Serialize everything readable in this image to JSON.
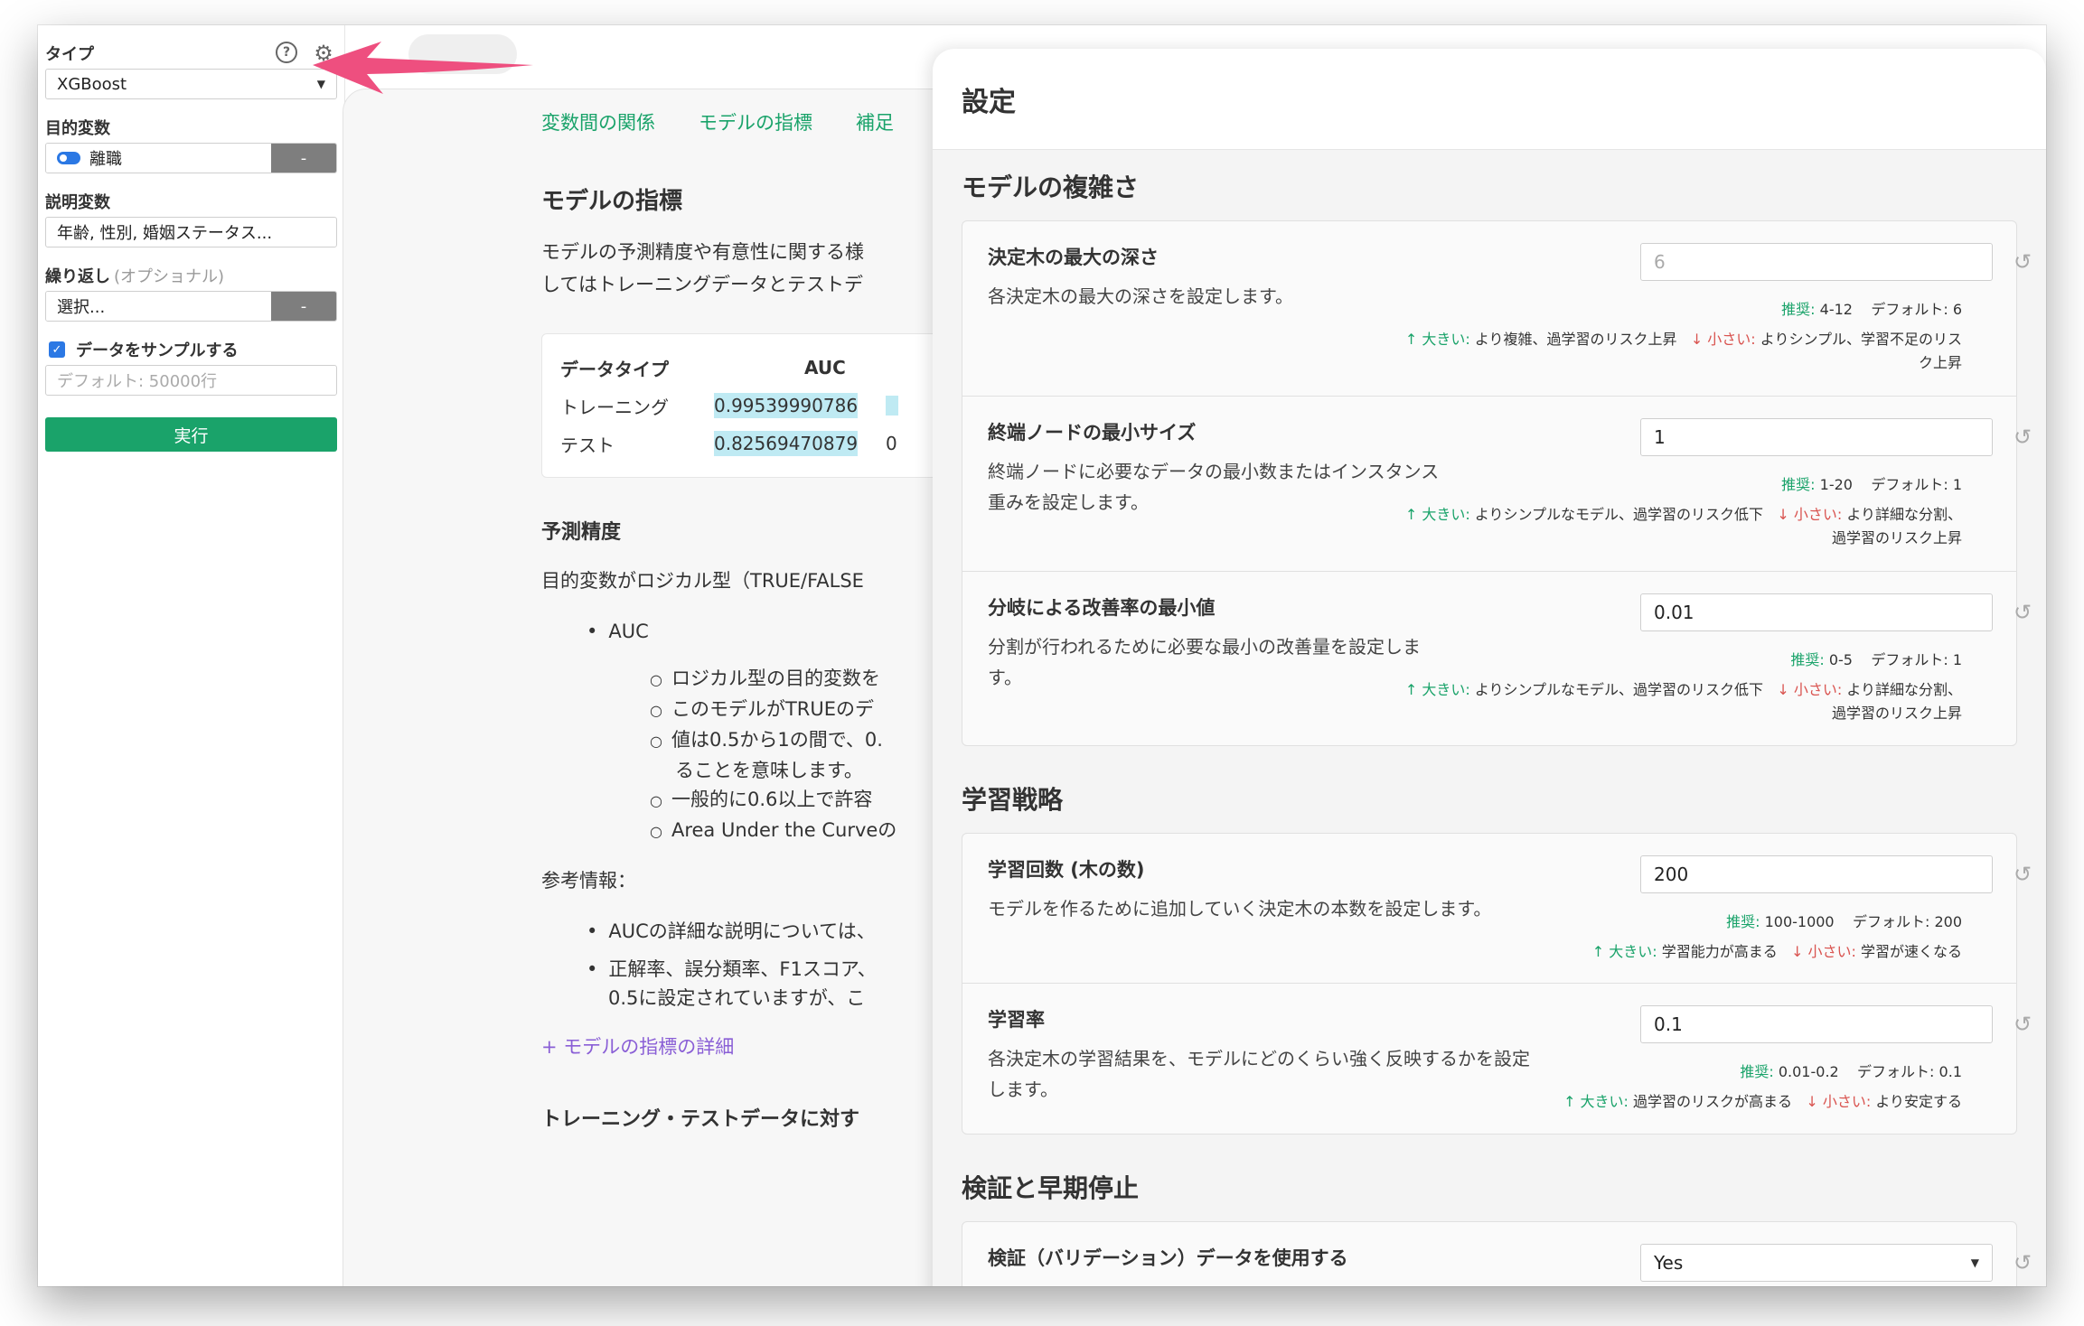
{
  "sidebar": {
    "type_label": "タイプ",
    "type_value": "XGBoost",
    "target_label": "目的変数",
    "target_value": "離職",
    "target_btn": "-",
    "features_label": "説明変数",
    "features_value": "年齢, 性別, 婚姻ステータス...",
    "repeat_label": "繰り返し",
    "repeat_optional": "(オプショナル)",
    "repeat_value": "選択...",
    "repeat_btn": "-",
    "sample_label": "データをサンプルする",
    "sample_placeholder": "デフォルト: 50000行",
    "run_label": "実行"
  },
  "doc": {
    "tabs": [
      "変数間の関係",
      "モデルの指標",
      "補足"
    ],
    "heading": "モデルの指標",
    "intro_line1": "モデルの予測精度や有意性に関する様",
    "intro_line2": "してはトレーニングデータとテストデ",
    "table": {
      "headers": [
        "データタイプ",
        "AUC"
      ],
      "rows": [
        {
          "type": "トレーニング",
          "auc": "0.99539990786"
        },
        {
          "type": "テスト",
          "auc": "0.82569470879"
        }
      ],
      "cut_mark": "0"
    },
    "accuracy_heading": "予測精度",
    "accuracy_text": "目的変数がロジカル型（TRUE/FALSE",
    "bullet_auc": "AUC",
    "sub_bullets": [
      "ロジカル型の目的変数を",
      "このモデルがTRUEのデ",
      "値は0.5から1の間で、0.",
      "一般的に0.6以上で許容",
      "Area Under the Curveの"
    ],
    "sub_bullet_cont": "ることを意味します。",
    "reference_label": "参考情報：",
    "ref_bullets": [
      "AUCの詳細な説明については、",
      "正解率、誤分類率、F1スコア、"
    ],
    "ref_cont": "0.5に設定されていますが、こ",
    "detail_link": "+ モデルの指標の詳細",
    "bottom_heading": "トレーニング・テストデータに対す"
  },
  "modal": {
    "title": "設定",
    "sections": [
      {
        "title": "モデルの複雑さ",
        "params": [
          {
            "name": "決定木の最大の深さ",
            "desc": "各決定木の最大の深さを設定します。",
            "value": "",
            "placeholder": "6",
            "rec_label": "推奨:",
            "rec": "4-12",
            "default_label": "デフォルト:",
            "default": "6",
            "up_label": "↑ 大きい:",
            "up_text": "より複雑、過学習のリスク上昇",
            "down_label": "↓ 小さい:",
            "down_text": "よりシンプル、学習不足のリスク上昇"
          },
          {
            "name": "終端ノードの最小サイズ",
            "desc": "終端ノードに必要なデータの最小数またはインスタンス重みを設定します。",
            "value": "1",
            "placeholder": "",
            "rec_label": "推奨:",
            "rec": "1-20",
            "default_label": "デフォルト:",
            "default": "1",
            "up_label": "↑ 大きい:",
            "up_text": "よりシンプルなモデル、過学習のリスク低下",
            "down_label": "↓ 小さい:",
            "down_text": "より詳細な分割、過学習のリスク上昇"
          },
          {
            "name": "分岐による改善率の最小値",
            "desc": "分割が行われるために必要な最小の改善量を設定します。",
            "value": "0.01",
            "placeholder": "",
            "rec_label": "推奨:",
            "rec": "0-5",
            "default_label": "デフォルト:",
            "default": "1",
            "up_label": "↑ 大きい:",
            "up_text": "よりシンプルなモデル、過学習のリスク低下",
            "down_label": "↓ 小さい:",
            "down_text": "より詳細な分割、過学習のリスク上昇"
          }
        ]
      },
      {
        "title": "学習戦略",
        "params": [
          {
            "name": "学習回数 (木の数)",
            "desc": "モデルを作るために追加していく決定木の本数を設定します。",
            "value": "200",
            "placeholder": "",
            "rec_label": "推奨:",
            "rec": "100-1000",
            "default_label": "デフォルト:",
            "default": "200",
            "up_label": "↑ 大きい:",
            "up_text": "学習能力が高まる",
            "down_label": "↓ 小さい:",
            "down_text": "学習が速くなる"
          },
          {
            "name": "学習率",
            "desc": "各決定木の学習結果を、モデルにどのくらい強く反映するかを設定します。",
            "value": "0.1",
            "placeholder": "",
            "rec_label": "推奨:",
            "rec": "0.01-0.2",
            "default_label": "デフォルト:",
            "default": "0.1",
            "up_label": "↑ 大きい:",
            "up_text": "過学習のリスクが高まる",
            "down_label": "↓ 小さい:",
            "down_text": "より安定する"
          }
        ]
      },
      {
        "title": "検証と早期停止",
        "params": [
          {
            "name": "検証（バリデーション）データを使用する",
            "value": "Yes"
          }
        ]
      }
    ]
  },
  "colors": {
    "accent_green": "#1aa36a",
    "arrow_pink": "#ee4f7f",
    "link_purple": "#8a5fd6",
    "toggle_blue": "#2b78e4"
  }
}
